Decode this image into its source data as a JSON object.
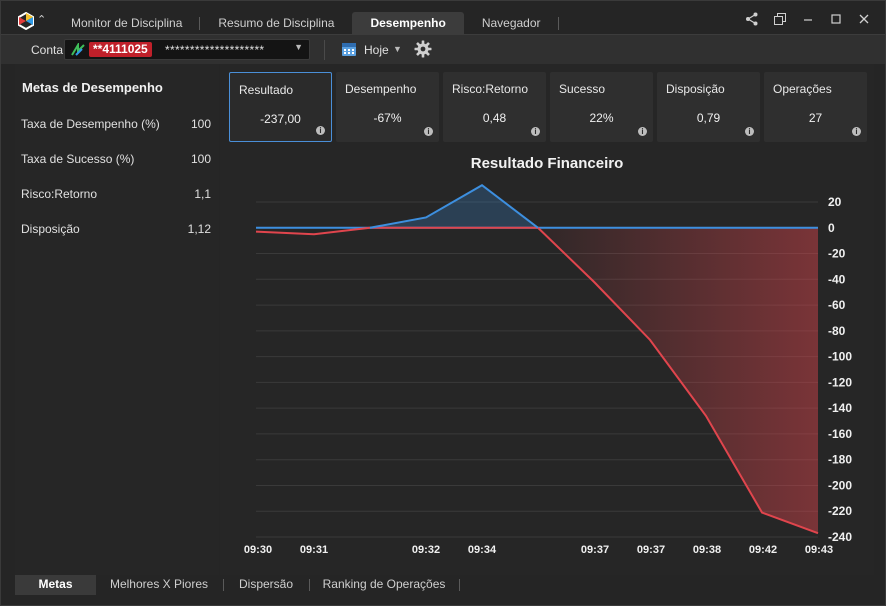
{
  "titlebar": {
    "tabs": [
      {
        "label": "Monitor de Disciplina",
        "active": false
      },
      {
        "label": "Resumo de Disciplina",
        "active": false
      },
      {
        "label": "Desempenho",
        "active": true
      },
      {
        "label": "Navegador",
        "active": false
      }
    ],
    "window_controls": [
      "share-icon",
      "restore-icon",
      "minimize-icon",
      "maximize-icon",
      "close-icon"
    ]
  },
  "toolbar": {
    "account_label": "Conta",
    "account_id": "**4111025",
    "account_masked": "********************",
    "period": "Hoje"
  },
  "metas": {
    "title": "Metas de Desempenho",
    "rows": [
      {
        "label": "Taxa de Desempenho (%)",
        "value": "100"
      },
      {
        "label": "Taxa de Sucesso (%)",
        "value": "100"
      },
      {
        "label": "Risco:Retorno",
        "value": "1,1"
      },
      {
        "label": "Disposição",
        "value": "1,12"
      }
    ]
  },
  "cards": [
    {
      "title": "Resultado",
      "value": "-237,00",
      "selected": true
    },
    {
      "title": "Desempenho",
      "value": "-67%",
      "selected": false
    },
    {
      "title": "Risco:Retorno",
      "value": "0,48",
      "selected": false
    },
    {
      "title": "Sucesso",
      "value": "22%",
      "selected": false
    },
    {
      "title": "Disposição",
      "value": "0,79",
      "selected": false
    },
    {
      "title": "Operações",
      "value": "27",
      "selected": false
    }
  ],
  "chart_data": {
    "type": "line",
    "title": "Resultado Financeiro",
    "x": [
      "09:30",
      "09:31",
      "09:32",
      "09:34",
      "09:37",
      "09:37",
      "09:38",
      "09:42",
      "09:43"
    ],
    "series": [
      {
        "color": "#e0454d",
        "values": [
          -3,
          -5,
          0,
          0,
          0,
          0,
          0,
          0,
          0
        ]
      },
      {
        "color": "#3d8fdf",
        "values": [
          0,
          0,
          8,
          33,
          0,
          0,
          0,
          0,
          0
        ]
      }
    ],
    "cumulative_line": [
      -3,
      -5,
      0,
      8,
      33,
      0,
      -42,
      -87,
      -146,
      -221,
      -237
    ],
    "y_ticks": [
      20,
      0,
      -20,
      -40,
      -60,
      -80,
      -100,
      -120,
      -140,
      -160,
      -180,
      -200,
      -220,
      -240
    ],
    "ylim": [
      -240,
      20
    ],
    "grid": true,
    "colors": {
      "positive": "#3d8fdf",
      "negative": "#e0454d",
      "zero_line": "#3d8fdf"
    }
  },
  "bottom_tabs": [
    {
      "label": "Metas",
      "active": true
    },
    {
      "label": "Melhores X Piores",
      "active": false
    },
    {
      "label": "Dispersão",
      "active": false
    },
    {
      "label": "Ranking de Operações",
      "active": false
    }
  ]
}
